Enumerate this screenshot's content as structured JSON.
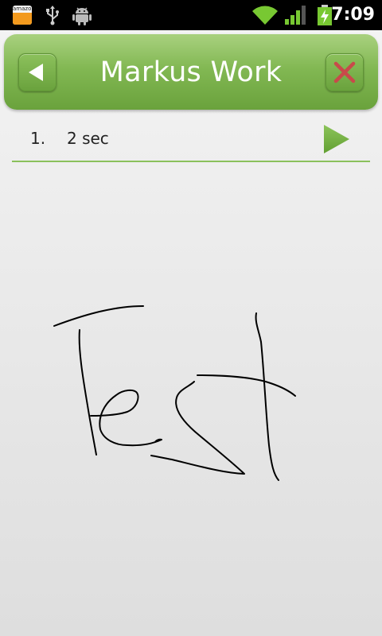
{
  "status_bar": {
    "time": "7:09",
    "icons": [
      "amazon-appstore-icon",
      "usb-icon",
      "android-debug-icon",
      "wifi-icon",
      "signal-icon",
      "battery-charging-icon"
    ],
    "amazon_label": "amazon"
  },
  "header": {
    "title": "Markus Work",
    "back_icon": "back-arrow-icon",
    "close_icon": "close-x-icon",
    "accent_color": "#82b853",
    "close_color": "#c84a4a"
  },
  "recordings": [
    {
      "index": "1.",
      "duration": "2 sec",
      "play_icon": "play-icon"
    }
  ],
  "canvas": {
    "sketch": "handwritten-text-sketch",
    "ink_color": "#000000"
  }
}
